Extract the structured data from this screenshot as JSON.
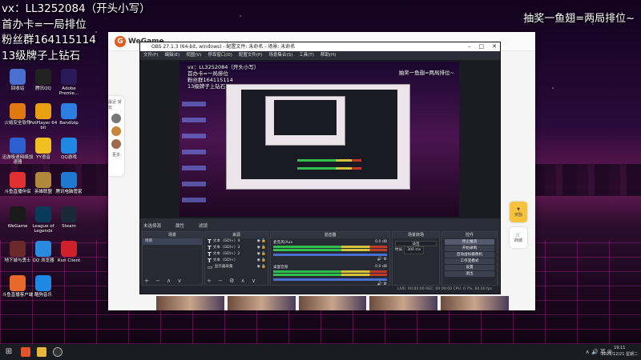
{
  "overlay": {
    "left_lines": [
      "vx：LL3252084（开头小写）",
      "首办卡=一局排位",
      "粉丝群164115114",
      "13级牌子上钻石"
    ],
    "right_text": "抽奖一鱼翅=两局排位~"
  },
  "desktop_icons": [
    {
      "name": "recycle-bin",
      "label": "回收站",
      "color": "#4a6fd3"
    },
    {
      "name": "tencent-qq",
      "label": "腾讯QQ",
      "color": "#222"
    },
    {
      "name": "adobe-premiere",
      "label": "Adobe Premie...",
      "color": "#2a1a5a"
    },
    {
      "name": "security-guard",
      "label": "火绒安全软件",
      "color": "#e07a10"
    },
    {
      "name": "potplayer",
      "label": "PotPlayer 64 bit",
      "color": "#e8a010"
    },
    {
      "name": "bandizip",
      "label": "Bandizip",
      "color": "#2c7fe0"
    },
    {
      "name": "xunlei",
      "label": "迅游极速网络加速器",
      "color": "#2c5fd0"
    },
    {
      "name": "yy-voice",
      "label": "YY语音",
      "color": "#f0c020"
    },
    {
      "name": "qq-game",
      "label": "QQ游戏",
      "color": "#1e88e5"
    },
    {
      "name": "douyu-live",
      "label": "斗鱼直播伴侣",
      "color": "#e03030"
    },
    {
      "name": "hero-alliance",
      "label": "英雄联盟",
      "color": "#b08a3a"
    },
    {
      "name": "tencent-butler",
      "label": "腾讯电脑管家",
      "color": "#1e7ad0"
    },
    {
      "name": "wegame",
      "label": "WeGame",
      "color": "#1a1a1a"
    },
    {
      "name": "league-of-legends",
      "label": "League of Legends",
      "color": "#0a3a5a"
    },
    {
      "name": "steam",
      "label": "Steam",
      "color": "#1b2838"
    },
    {
      "name": "dnf",
      "label": "地下城与勇士",
      "color": "#6a2a2a"
    },
    {
      "name": "qq-browser",
      "label": "QQ 浏览器",
      "color": "#2a8ae0"
    },
    {
      "name": "riot-client",
      "label": "Riot Client",
      "color": "#d0202a"
    },
    {
      "name": "douyu-pc",
      "label": "斗鱼直播客户端",
      "color": "#e8682a"
    },
    {
      "name": "kugou",
      "label": "酷狗音乐",
      "color": "#1e88e5"
    }
  ],
  "wegame": {
    "logo_text": "WeGame",
    "side_label_top": "最近 常玩",
    "side_label_bottom": "更多",
    "rail_items": [
      "奖励",
      "商城",
      "超值"
    ]
  },
  "obs": {
    "title": "OBS 27.1.3 (64-bit, windows) - 配置文件: 未命名 - 场景: 未命名",
    "menu": [
      "文件(F)",
      "编辑(E)",
      "视图(V)",
      "停靠窗口(D)",
      "配置文件(P)",
      "场景集合(S)",
      "工具(T)",
      "帮助(H)"
    ],
    "preview_left_lines": [
      "vx：LL3252084（开头小写）",
      "首办卡=一局排位",
      "粉丝群164115114",
      "13级牌子上钻石"
    ],
    "preview_right_text": "抽奖一鱼翅=两局排位~",
    "selection_bar": [
      "未选择源",
      "属性",
      "滤镜"
    ],
    "docks": {
      "scenes": {
        "title": "场景",
        "items": [
          "场景"
        ]
      },
      "sources": {
        "title": "来源",
        "items": [
          "文本（GDI+）4",
          "文本（GDI+）3",
          "文本（GDI+）2",
          "文本（GDI+）",
          "显示器采集"
        ]
      },
      "mixer": {
        "title": "混音器",
        "channels": [
          {
            "name": "麦克风/Aux",
            "level": "0.0 dB"
          },
          {
            "name": "桌面音频",
            "level": "0.0 dB"
          }
        ]
      },
      "transitions": {
        "title": "场景转场",
        "type": "淡出",
        "duration_label": "时长",
        "duration": "300 ms"
      },
      "controls": {
        "title": "控件",
        "buttons": [
          "停止推流",
          "开始录制",
          "启动虚拟摄像机",
          "工作室模式",
          "设置",
          "退出"
        ]
      }
    },
    "status": "LIVE: 00:00:00   REC: 00:00:00   CPU: 0.7%, 60.00 fps"
  },
  "taskbar": {
    "start_icon": "windows-icon",
    "tray_text": "∧ 🔊 英 ⊞",
    "time": "19:11",
    "date": "2021/12/21 星期二"
  }
}
